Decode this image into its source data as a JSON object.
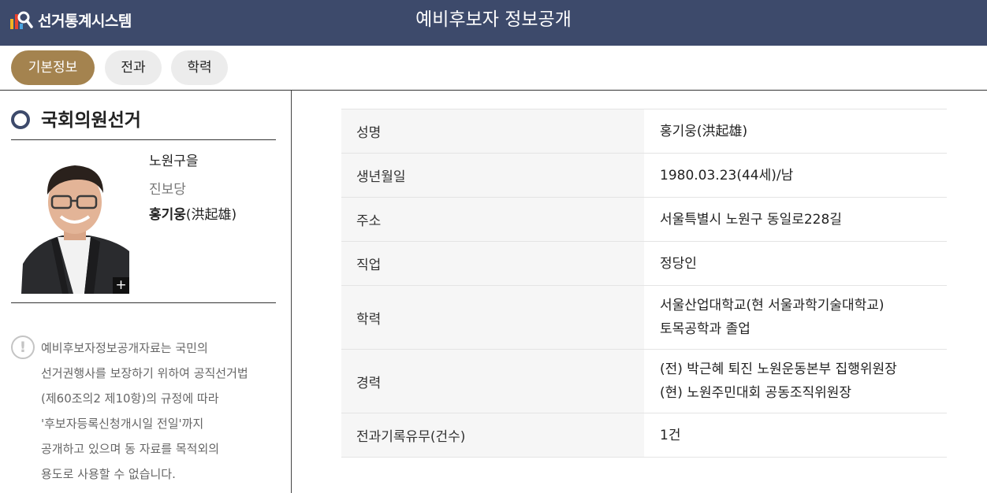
{
  "header": {
    "logo_text": "선거통계시스템",
    "title": "예비후보자 정보공개"
  },
  "tabs": [
    {
      "label": "기본정보",
      "active": true
    },
    {
      "label": "전과",
      "active": false
    },
    {
      "label": "학력",
      "active": false
    }
  ],
  "sidebar": {
    "election_type": "국회의원선거",
    "district": "노원구을",
    "party": "진보당",
    "name_ko": "홍기웅",
    "name_hanja": "(洪起雄)",
    "photo_expand": "+",
    "notice_icon": "!",
    "notice_lines": [
      "예비후보자정보공개자료는 국민의",
      "선거권행사를 보장하기 위하여 공직선거법",
      "(제60조의2 제10항)의 규정에 따라",
      "'후보자등록신청개시일 전일'까지",
      "공개하고 있으며 동 자료를 목적외의",
      "용도로 사용할 수 없습니다."
    ]
  },
  "info_table": [
    {
      "label": "성명",
      "values": [
        "홍기웅(洪起雄)"
      ]
    },
    {
      "label": "생년월일",
      "values": [
        "1980.03.23(44세)/남"
      ]
    },
    {
      "label": "주소",
      "values": [
        "서울특별시 노원구 동일로228길"
      ]
    },
    {
      "label": "직업",
      "values": [
        "정당인"
      ]
    },
    {
      "label": "학력",
      "values": [
        "서울산업대학교(현 서울과학기술대학교)",
        "토목공학과 졸업"
      ]
    },
    {
      "label": "경력",
      "values": [
        "(전) 박근혜 퇴진 노원운동본부 집행위원장",
        "(현) 노원주민대회 공동조직위원장"
      ]
    },
    {
      "label": "전과기록유무(건수)",
      "values": [
        "1건"
      ]
    }
  ],
  "colors": {
    "header_bg": "#3d4a6b",
    "active_tab": "#a4834f",
    "inactive_tab": "#ececec",
    "label_bg": "#f6f6f6"
  }
}
